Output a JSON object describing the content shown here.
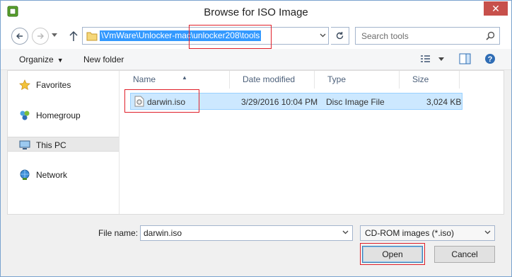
{
  "window": {
    "title": "Browse for ISO Image",
    "close_symbol": "✕"
  },
  "navigation": {
    "address_path": "\\VmWare\\Unlocker-mac\\unlocker208\\tools",
    "search_placeholder": "Search tools"
  },
  "toolbar": {
    "organize_label": "Organize",
    "new_folder_label": "New folder"
  },
  "sidebar": {
    "items": [
      {
        "label": "Favorites",
        "icon": "star-icon"
      },
      {
        "label": "Homegroup",
        "icon": "homegroup-icon"
      },
      {
        "label": "This PC",
        "icon": "computer-icon",
        "selected": true
      },
      {
        "label": "Network",
        "icon": "network-icon"
      }
    ]
  },
  "file_list": {
    "columns": [
      "Name",
      "Date modified",
      "Type",
      "Size"
    ],
    "rows": [
      {
        "name": "darwin.iso",
        "date_modified": "3/29/2016 10:04 PM",
        "type": "Disc Image File",
        "size": "3,024 KB"
      }
    ]
  },
  "footer": {
    "file_name_label": "File name:",
    "file_name_value": "darwin.iso",
    "file_type_filter": "CD-ROM images (*.iso)",
    "open_label": "Open",
    "cancel_label": "Cancel"
  },
  "colors": {
    "selection": "#cce8ff",
    "address_highlight": "#3399ff",
    "annotation_red": "#e0202a",
    "close_button": "#c7504b"
  }
}
